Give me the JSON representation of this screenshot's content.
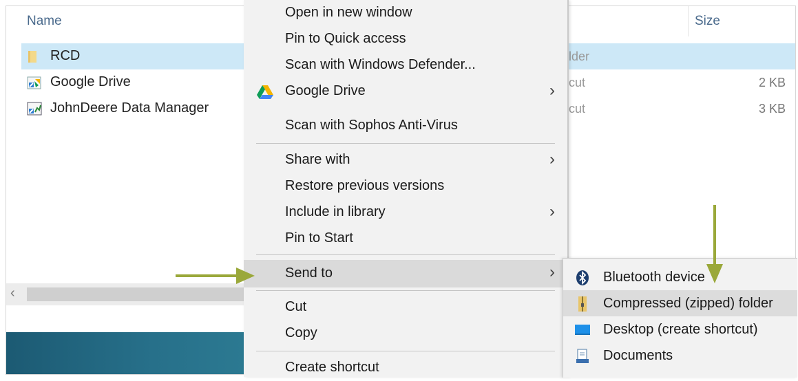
{
  "explorer": {
    "columns": {
      "name": "Name",
      "size": "Size"
    },
    "rows": [
      {
        "name": "RCD",
        "type": "lder",
        "size": "",
        "icon": "folder-icon",
        "selected": true
      },
      {
        "name": "Google Drive",
        "type": "cut",
        "size": "2 KB",
        "icon": "shortcut-icon",
        "selected": false
      },
      {
        "name": "JohnDeere Data Manager",
        "type": "cut",
        "size": "3 KB",
        "icon": "shortcut-icon",
        "selected": false
      }
    ],
    "scroll_left_glyph": "‹"
  },
  "context_menu": {
    "items": [
      {
        "label": "Open in new window"
      },
      {
        "label": "Pin to Quick access"
      },
      {
        "label": "Scan with Windows Defender..."
      },
      {
        "label": "Google Drive",
        "submenu": true,
        "icon": "google-drive-icon"
      },
      {
        "label": "Scan with Sophos Anti-Virus"
      },
      {
        "label": "Share with",
        "submenu": true
      },
      {
        "label": "Restore previous versions"
      },
      {
        "label": "Include in library",
        "submenu": true
      },
      {
        "label": "Pin to Start"
      },
      {
        "label": "Send to",
        "submenu": true,
        "highlighted": true
      },
      {
        "label": "Cut"
      },
      {
        "label": "Copy"
      },
      {
        "label": "Create shortcut"
      }
    ],
    "chevron": "›"
  },
  "send_to_submenu": {
    "items": [
      {
        "label": "Bluetooth device",
        "icon": "bluetooth-icon"
      },
      {
        "label": "Compressed (zipped) folder",
        "icon": "zip-folder-icon",
        "highlighted": true
      },
      {
        "label": "Desktop (create shortcut)",
        "icon": "desktop-icon"
      },
      {
        "label": "Documents",
        "icon": "documents-icon"
      }
    ]
  },
  "colors": {
    "selection": "#cde8f7",
    "menu_bg": "#f2f2f2",
    "menu_highlight": "#dadada",
    "annotation_arrow": "#9aa83a",
    "header_text": "#4a6a8c"
  }
}
